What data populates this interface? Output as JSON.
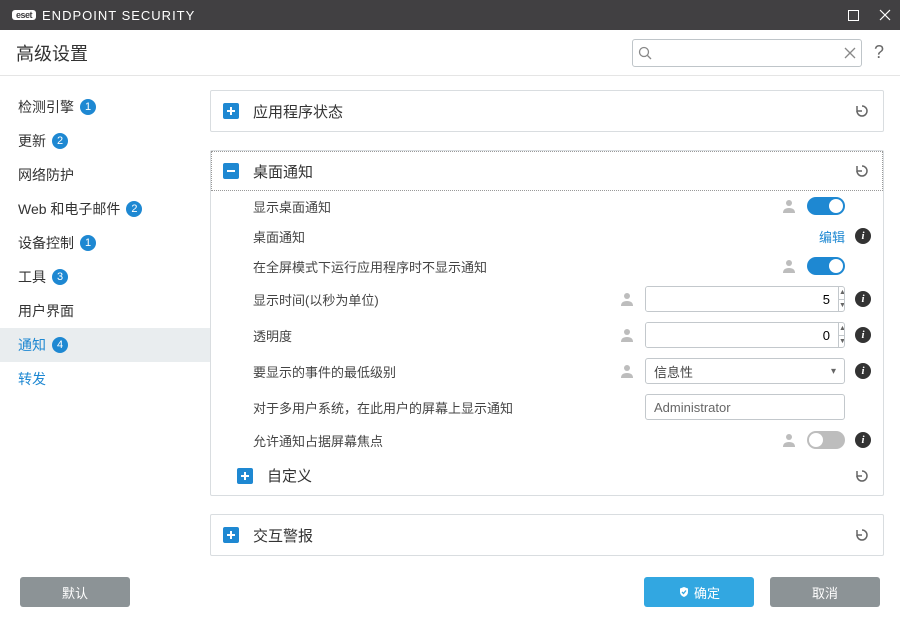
{
  "window": {
    "brand_badge": "eset",
    "brand_text": "ENDPOINT SECURITY",
    "title": "高级设置"
  },
  "search": {
    "value": "",
    "placeholder": ""
  },
  "sidebar": {
    "items": [
      {
        "label": "检测引擎",
        "badge": "1"
      },
      {
        "label": "更新",
        "badge": "2"
      },
      {
        "label": "网络防护",
        "badge": null
      },
      {
        "label": "Web 和电子邮件",
        "badge": "2"
      },
      {
        "label": "设备控制",
        "badge": "1"
      },
      {
        "label": "工具",
        "badge": "3"
      },
      {
        "label": "用户界面",
        "badge": null
      }
    ],
    "sub": [
      {
        "label": "通知",
        "badge": "4",
        "selected": true
      },
      {
        "label": "转发",
        "badge": null,
        "selected": false
      }
    ]
  },
  "panels": {
    "app_status": {
      "title": "应用程序状态"
    },
    "desktop": {
      "title": "桌面通知",
      "rows": {
        "show": {
          "label": "显示桌面通知",
          "on": true
        },
        "edit": {
          "label": "桌面通知",
          "link": "编辑"
        },
        "fullscreen": {
          "label": "在全屏模式下运行应用程序时不显示通知",
          "on": true
        },
        "duration": {
          "label": "显示时间(以秒为单位)",
          "value": "5"
        },
        "opacity": {
          "label": "透明度",
          "value": "0"
        },
        "level": {
          "label": "要显示的事件的最低级别",
          "value": "信息性"
        },
        "user": {
          "label": "对于多用户系统，在此用户的屏幕上显示通知",
          "value": "Administrator"
        },
        "focus": {
          "label": "允许通知占据屏幕焦点",
          "on": false
        }
      },
      "custom": {
        "title": "自定义"
      }
    },
    "interactive": {
      "title": "交互警报"
    }
  },
  "footer": {
    "default": "默认",
    "ok": "确定",
    "cancel": "取消"
  }
}
